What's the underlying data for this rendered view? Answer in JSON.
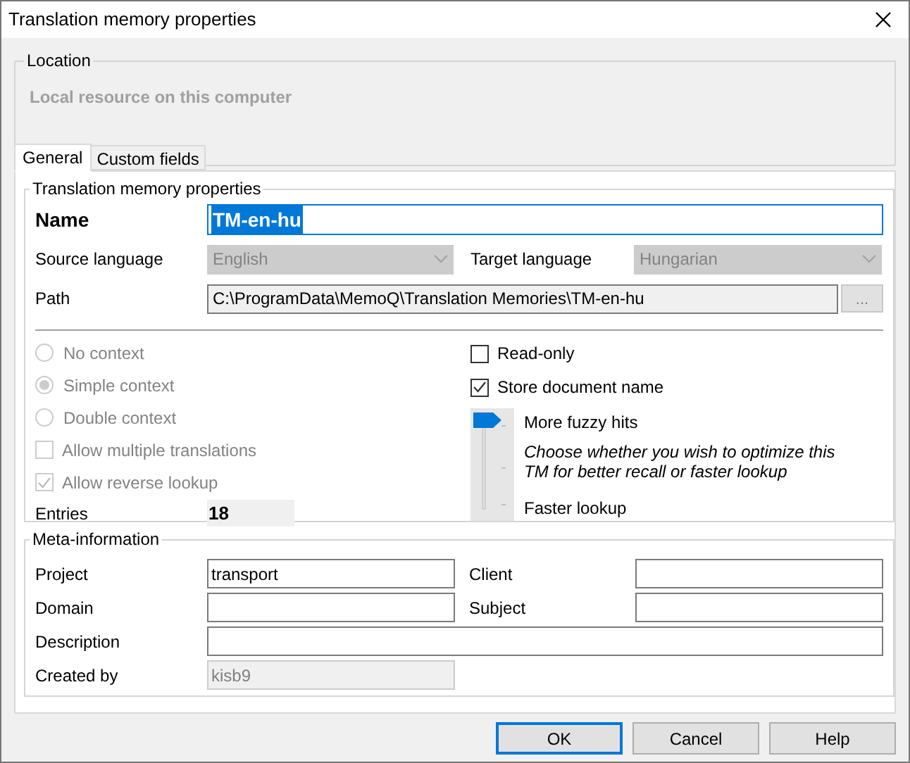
{
  "window": {
    "title": "Translation memory properties"
  },
  "location": {
    "label": "Location",
    "value": "Local resource on this computer"
  },
  "tabs": [
    {
      "label": "General",
      "selected": true
    },
    {
      "label": "Custom fields",
      "selected": false
    }
  ],
  "properties": {
    "label": "Translation memory properties",
    "name": {
      "label": "Name",
      "value": "TM-en-hu",
      "selected": true
    },
    "source_language": {
      "label": "Source language",
      "value": "English",
      "disabled": true
    },
    "target_language": {
      "label": "Target language",
      "value": "Hungarian",
      "disabled": true
    },
    "path": {
      "label": "Path",
      "value": "C:\\ProgramData\\MemoQ\\Translation Memories\\TM-en-hu",
      "browse": "..."
    },
    "context_options": [
      {
        "label": "No context",
        "selected": false,
        "disabled": true
      },
      {
        "label": "Simple context",
        "selected": true,
        "disabled": true
      },
      {
        "label": "Double context",
        "selected": false,
        "disabled": true
      }
    ],
    "options": [
      {
        "label": "Allow multiple translations",
        "checked": false,
        "disabled": true
      },
      {
        "label": "Allow reverse lookup",
        "checked": true,
        "disabled": true
      }
    ],
    "entries": {
      "label": "Entries",
      "value": "18"
    },
    "right_options": [
      {
        "label": "Read-only",
        "checked": false,
        "disabled": false
      },
      {
        "label": "Store document name",
        "checked": true,
        "disabled": false
      }
    ],
    "optimization": {
      "level": 1,
      "top_label": "More fuzzy hits",
      "description": "Choose whether you wish to optimize this TM for better recall or faster lookup",
      "bottom_label": "Faster lookup"
    }
  },
  "meta": {
    "label": "Meta-information",
    "fields": [
      {
        "label": "Project",
        "value": "transport",
        "disabled": false
      },
      {
        "label": "Client",
        "disabled": false
      },
      {
        "label": "Domain",
        "disabled": false
      },
      {
        "label": "Subject",
        "disabled": false
      },
      {
        "label": "Description",
        "disabled": false
      },
      {
        "label": "Created by",
        "value": "kisb9",
        "disabled": true
      }
    ]
  },
  "buttons": [
    {
      "label": "OK",
      "default": true
    },
    {
      "label": "Cancel",
      "default": false
    },
    {
      "label": "Help",
      "default": false
    }
  ]
}
